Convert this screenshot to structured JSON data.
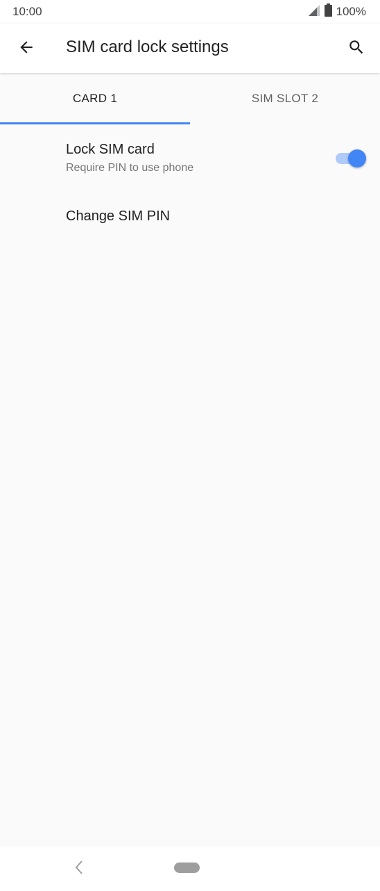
{
  "status_bar": {
    "time": "10:00",
    "battery_text": "100%",
    "icons": [
      "signal-icon",
      "battery-icon"
    ]
  },
  "app_bar": {
    "title": "SIM card lock settings",
    "back_icon": "back-arrow-icon",
    "search_icon": "search-icon"
  },
  "tabs": [
    {
      "label": "CARD 1",
      "selected": true
    },
    {
      "label": "SIM SLOT 2",
      "selected": false
    }
  ],
  "settings": {
    "lock_sim": {
      "title": "Lock SIM card",
      "summary": "Require PIN to use phone",
      "enabled": true
    },
    "change_pin": {
      "title": "Change SIM PIN"
    }
  },
  "nav_bar": {
    "icons": [
      "nav-back-icon",
      "nav-home-pill"
    ]
  },
  "colors": {
    "accent": "#4285f4",
    "toggle_track": "#aecbfa",
    "background": "#fafafa"
  }
}
